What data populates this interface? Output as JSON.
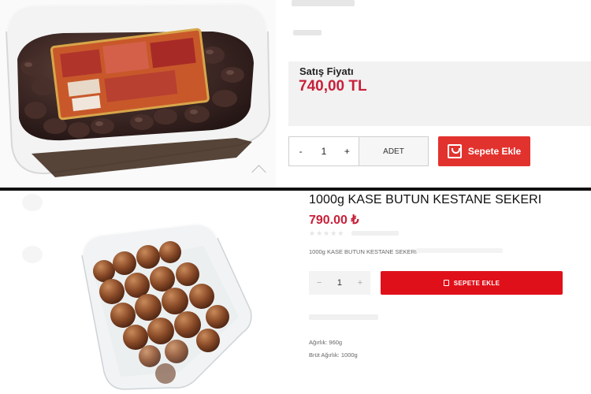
{
  "top": {
    "price_label": "Satış Fiyatı",
    "price": "740,00 TL",
    "quantity": "1",
    "minus": "-",
    "plus": "+",
    "unit": "ADET",
    "add_to_cart": "Sepete Ekle"
  },
  "bottom": {
    "title": "1000g KASE BUTUN KESTANE SEKERI",
    "price": "790.00 ₺",
    "short_description": "1000g KASE BUTUN KESTANE SEKERI",
    "quantity": "1",
    "minus": "−",
    "plus": "+",
    "add_to_cart": "SEPETE EKLE",
    "weight": "Ağırlık: 960g",
    "gross_weight": "Brüt Ağırlık: 1000g"
  },
  "colors": {
    "price_red": "#c8203a",
    "button_red_top": "#e2322e",
    "button_red_bottom": "#e0101a",
    "divider": "#111111"
  }
}
